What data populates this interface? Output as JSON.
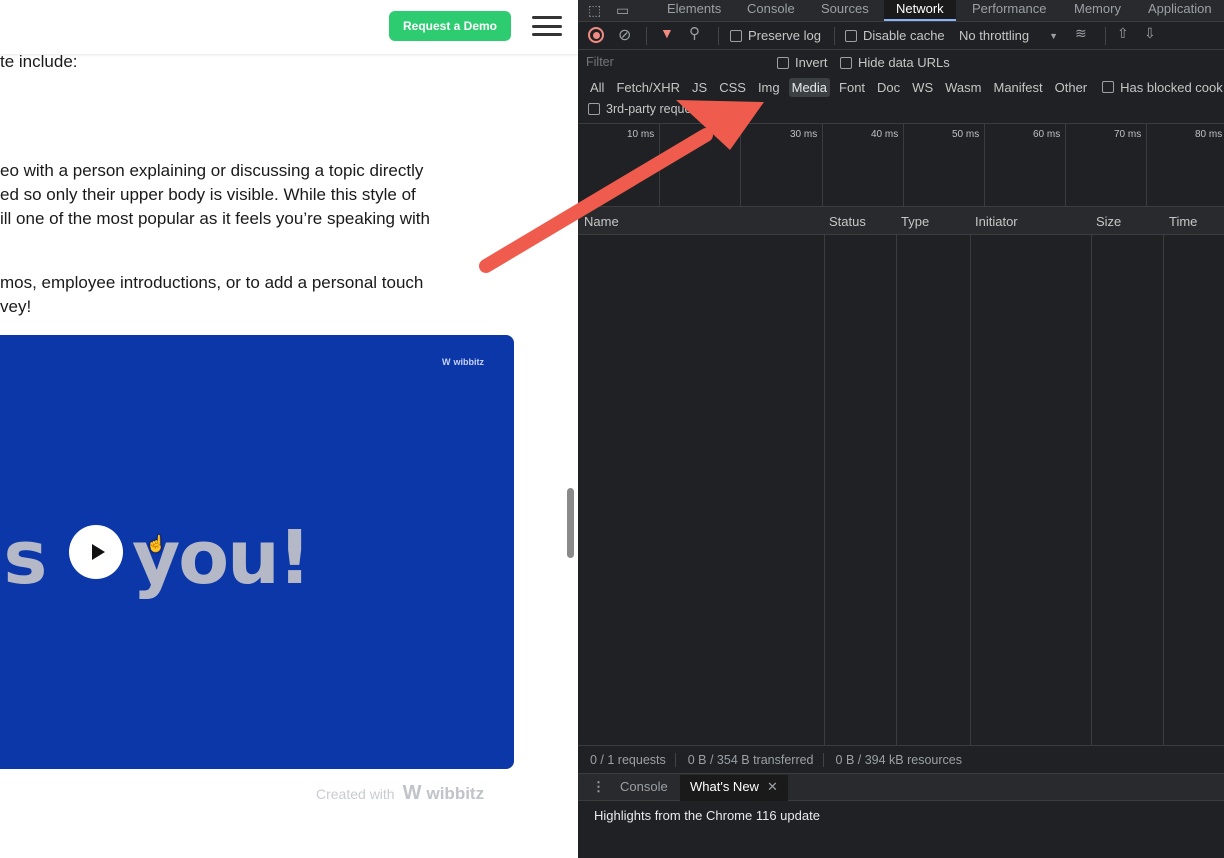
{
  "page": {
    "header": {
      "demo_button": "Request a Demo"
    },
    "paragraph1": "te include:",
    "paragraph2_lines": [
      "eo with a person explaining or discussing a topic directly",
      "ed so only their upper body is visible. While this style of",
      "ill one of the most popular as it feels you’re speaking with"
    ],
    "paragraph3_lines": [
      "mos, employee introductions, or to add a personal touch",
      "vey!"
    ],
    "video": {
      "logo_text": "wibbitz",
      "overlay_text_left": "is",
      "overlay_text_right": "you!"
    },
    "footer": {
      "created_with": "Created with",
      "brand": "wibbitz"
    }
  },
  "devtools": {
    "tabs": [
      "Elements",
      "Console",
      "Sources",
      "Network",
      "Performance",
      "Memory",
      "Application"
    ],
    "active_tab": "Network",
    "toolbar": {
      "preserve_log": "Preserve log",
      "disable_cache": "Disable cache",
      "throttling": "No throttling"
    },
    "filter": {
      "placeholder": "Filter",
      "invert": "Invert",
      "hide_data_urls": "Hide data URLs"
    },
    "types": [
      "All",
      "Fetch/XHR",
      "JS",
      "CSS",
      "Img",
      "Media",
      "Font",
      "Doc",
      "WS",
      "Wasm",
      "Manifest",
      "Other"
    ],
    "active_type": "Media",
    "has_blocked": "Has blocked cook",
    "third_party": "3rd-party requests",
    "timeline_ticks": [
      "10 ms",
      "",
      "30 ms",
      "40 ms",
      "50 ms",
      "60 ms",
      "70 ms",
      "80 ms"
    ],
    "columns": [
      "Name",
      "Status",
      "Type",
      "Initiator",
      "Size",
      "Time"
    ],
    "status": {
      "requests": "0 / 1 requests",
      "transferred": "0 B / 354 B transferred",
      "resources": "0 B / 394 kB resources"
    },
    "drawer": {
      "tabs": [
        "Console",
        "What's New"
      ],
      "active": "What's New",
      "body": "Highlights from the Chrome 116 update"
    }
  },
  "colors": {
    "accent_green": "#2ecc71",
    "video_blue": "#0c37a8",
    "devtools_bg": "#202124",
    "arrow_red": "#ef5b4c"
  }
}
